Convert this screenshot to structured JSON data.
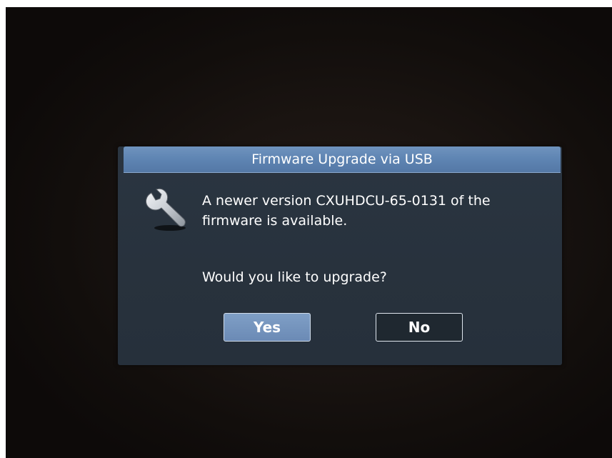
{
  "dialog": {
    "title": "Firmware Upgrade via USB",
    "message": "A newer version CXUHDCU-65-0131 of the firmware is available.",
    "question": "Would you like to upgrade?",
    "icon": "wrench-icon",
    "yes_label": "Yes",
    "no_label": "No",
    "selected_button": "Yes"
  },
  "colors": {
    "title_bar": "#6b8ebb",
    "dialog_bg": "#28323d",
    "yes_button": "#7494bf",
    "screen_bg": "#1a1411"
  }
}
